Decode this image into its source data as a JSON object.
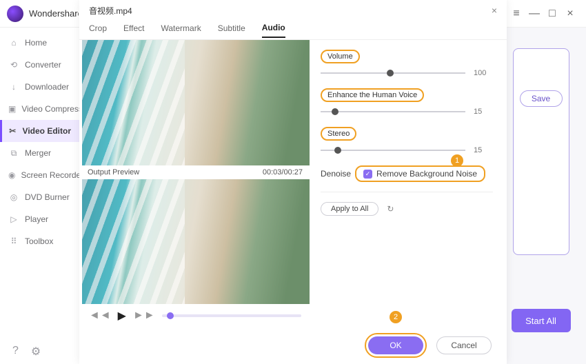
{
  "app": {
    "brand": "Wondershare"
  },
  "win": {
    "menu": "≡",
    "min": "—",
    "max": "□",
    "close": "×"
  },
  "sidebar": {
    "items": [
      {
        "icon": "⌂",
        "label": "Home"
      },
      {
        "icon": "⟲",
        "label": "Converter"
      },
      {
        "icon": "↓",
        "label": "Downloader"
      },
      {
        "icon": "▣",
        "label": "Video Compressor"
      },
      {
        "icon": "✂",
        "label": "Video Editor"
      },
      {
        "icon": "⧉",
        "label": "Merger"
      },
      {
        "icon": "◉",
        "label": "Screen Recorder"
      },
      {
        "icon": "◎",
        "label": "DVD Burner"
      },
      {
        "icon": "▷",
        "label": "Player"
      },
      {
        "icon": "⠿",
        "label": "Toolbox"
      }
    ],
    "active_index": 4,
    "help": "?",
    "settings": "⚙"
  },
  "right": {
    "save": "Save",
    "start_all": "Start All"
  },
  "modal": {
    "title": "音视频.mp4",
    "tabs": [
      {
        "label": "Crop"
      },
      {
        "label": "Effect"
      },
      {
        "label": "Watermark"
      },
      {
        "label": "Subtitle"
      },
      {
        "label": "Audio"
      }
    ],
    "active_tab": 4,
    "preview": {
      "label": "Output Preview",
      "time": "00:03/00:27"
    },
    "audio": {
      "volume": {
        "label": "Volume",
        "value": 100,
        "pos": 48
      },
      "enhance": {
        "label": "Enhance the Human Voice",
        "value": 15,
        "pos": 10
      },
      "stereo": {
        "label": "Stereo",
        "value": 15,
        "pos": 12
      },
      "denoise_label": "Denoise",
      "remove_noise": "Remove Background Noise",
      "badge1": "1"
    },
    "apply_all": "Apply to All",
    "reset": "↻",
    "ok": "OK",
    "cancel": "Cancel",
    "badge2": "2"
  },
  "transport": {
    "prev": "◄◄",
    "play": "▶",
    "next": "►►"
  }
}
